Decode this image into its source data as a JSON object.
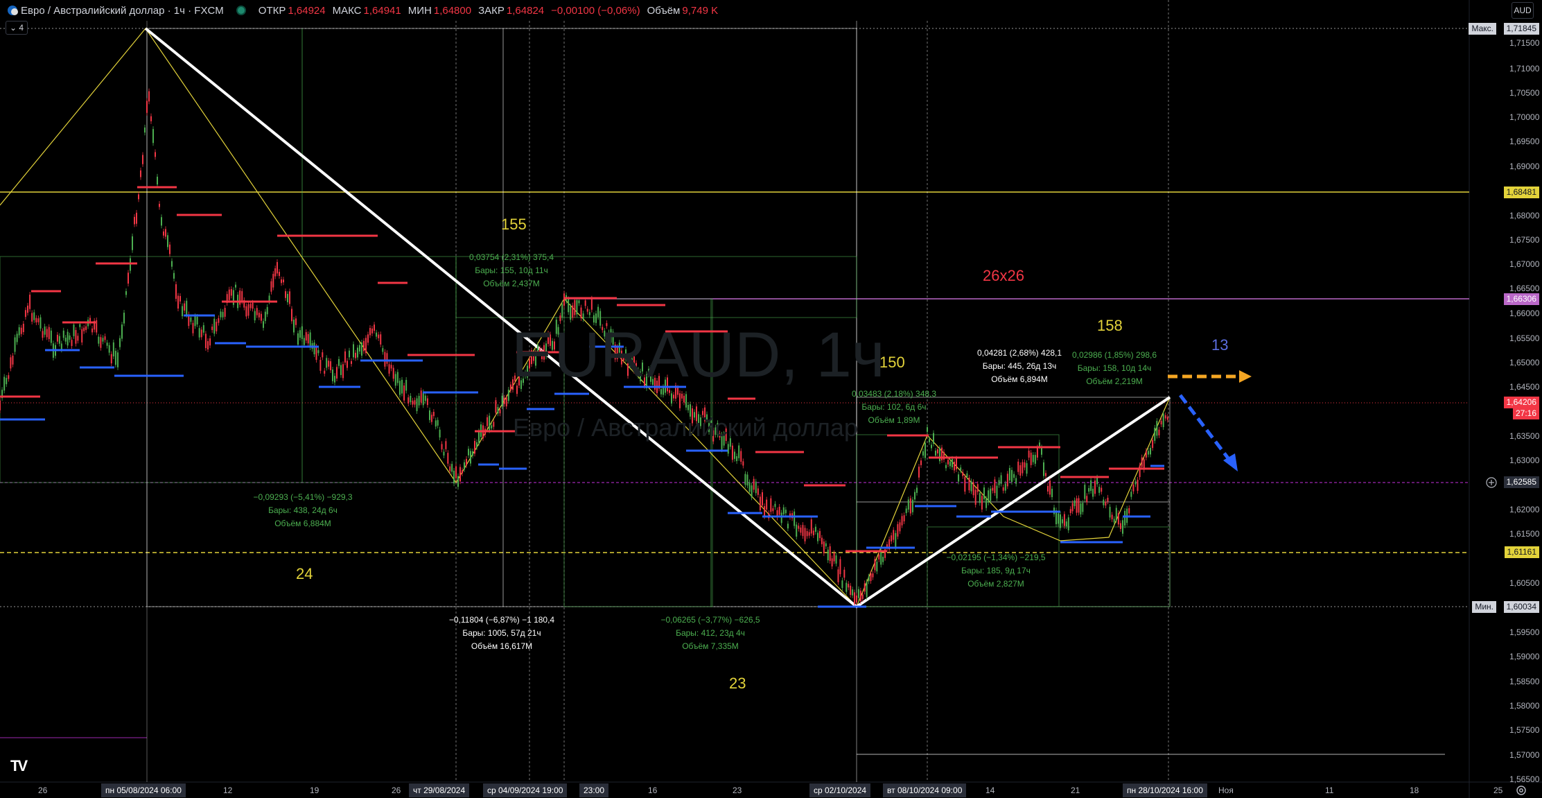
{
  "header": {
    "title": "Евро / Австралийский доллар · 1ч · FXCM",
    "open_label": "ОТКР",
    "open_value": "1,64924",
    "high_label": "МАКС",
    "high_value": "1,64941",
    "low_label": "МИН",
    "low_value": "1,64800",
    "close_label": "ЗАКР",
    "close_value": "1,64824",
    "change_value": "−0,00100 (−0,06%)",
    "volume_label": "Объём",
    "volume_value": "9,749 K",
    "status_color": "#1e8a6e"
  },
  "toolbar": {
    "indicator_toggle": "⌄ 4",
    "currency": "AUD"
  },
  "watermark": {
    "symbol": "EURAUD, 1ч",
    "name": "Евро / Австралийский доллар"
  },
  "price_axis": {
    "ticks": [
      "1,71500",
      "1,71000",
      "1,70500",
      "1,70000",
      "1,69500",
      "1,69000",
      "1,68000",
      "1,67500",
      "1,67000",
      "1,66500",
      "1,66000",
      "1,65500",
      "1,65000",
      "1,64500",
      "1,63500",
      "1,63000",
      "1,62000",
      "1,61500",
      "1,60500",
      "1,59500",
      "1,59000",
      "1,58500",
      "1,58000",
      "1,57500",
      "1,57000",
      "1,56500"
    ],
    "labels": {
      "max_tag": "Макс.",
      "max_value": "1,71845",
      "level_1": "1,68481",
      "level_2": "1,66306",
      "current_price": "1,64206",
      "countdown": "27:16",
      "crosshair": "1,62585",
      "level_3": "1,61161",
      "min_tag": "Мин.",
      "min_value": "1,60034"
    }
  },
  "time_axis": {
    "ticks": [
      {
        "t": "26"
      },
      {
        "t": "12"
      },
      {
        "t": "19"
      },
      {
        "t": "26"
      },
      {
        "t": "16"
      },
      {
        "t": "23"
      },
      {
        "t": "14"
      },
      {
        "t": "21"
      },
      {
        "t": "Ноя"
      },
      {
        "t": "11"
      },
      {
        "t": "18"
      },
      {
        "t": "25"
      }
    ],
    "highlights": [
      "пн 05/08/2024   06:00",
      "чт 29/08/2024",
      "ср 04/09/2024   19:00",
      "23:00",
      "ср 02/10/2024",
      "вт 08/10/2024   09:00",
      "пн 28/10/2024   16:00"
    ]
  },
  "annotations": {
    "a1": {
      "l1": "0,03754 (2,31%) 375,4",
      "l2": "Бары: 155, 10д 11ч",
      "l3": "Объём 2,437M"
    },
    "a2": {
      "l1": "−0,09293 (−5,41%) −929,3",
      "l2": "Бары: 438, 24д 6ч",
      "l3": "Объём 6,884M"
    },
    "a3": {
      "l1": "−0,11804 (−6,87%) −1 180,4",
      "l2": "Бары: 1005, 57д 21ч",
      "l3": "Объём 16,617M"
    },
    "a4": {
      "l1": "−0,06265 (−3,77%) −626,5",
      "l2": "Бары: 412, 23д 4ч",
      "l3": "Объём 7,335M"
    },
    "a5": {
      "l1": "0,03483 (2,18%) 348,3",
      "l2": "Бары: 102, 6д 6ч",
      "l3": "Объём 1,89M"
    },
    "a6": {
      "l1": "0,04281 (2,68%) 428,1",
      "l2": "Бары: 445, 26д 13ч",
      "l3": "Объём 6,894M"
    },
    "a7": {
      "l1": "0,02986 (1,85%) 298,6",
      "l2": "Бары: 158, 10д 14ч",
      "l3": "Объём 2,219M"
    },
    "a8": {
      "l1": "−0,02195 (−1,34%) −219,5",
      "l2": "Бары: 185, 9д 17ч",
      "l3": "Объём 2,827M"
    }
  },
  "labels": {
    "n155": "155",
    "n24": "24",
    "n23": "23",
    "n150": "150",
    "n158": "158",
    "n13": "13",
    "n26x26": "26x26"
  },
  "colors": {
    "down": "#f23645",
    "up": "#4caf50",
    "accent": "#2962ff",
    "level": "#e3d33a",
    "purple": "#9c27b0",
    "orange": "#f5a623"
  },
  "logo": "TV"
}
